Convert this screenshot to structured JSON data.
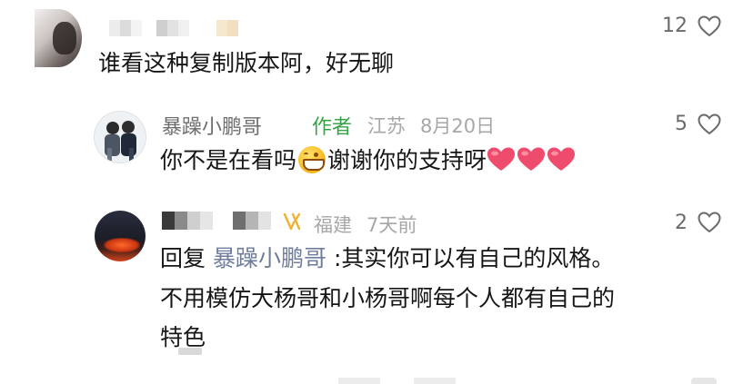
{
  "top_comment": {
    "text": "谁看这种复制版本阿，好无聊",
    "likes": "12"
  },
  "author_reply": {
    "name": "暴躁小鹏哥",
    "tag": "作者",
    "location": "江苏",
    "date": "8月20日",
    "text": "你不是在看吗",
    "text_after_emoji": "谢谢你的支持呀",
    "likes": "5"
  },
  "reply_two": {
    "location": "福建",
    "date": "7天前",
    "likes": "2",
    "reply_prefix": "回复",
    "mention": "暴躁小鹏哥",
    "line1_rest": ":其实你可以有自己的风格。",
    "line2": "不用模仿大杨哥和小杨哥啊每个人都有自己的",
    "line3": "特色"
  },
  "colors": {
    "author_tag": "#3aa34a",
    "heart": "#ef4b6c",
    "mention": "#6e7d9c"
  }
}
